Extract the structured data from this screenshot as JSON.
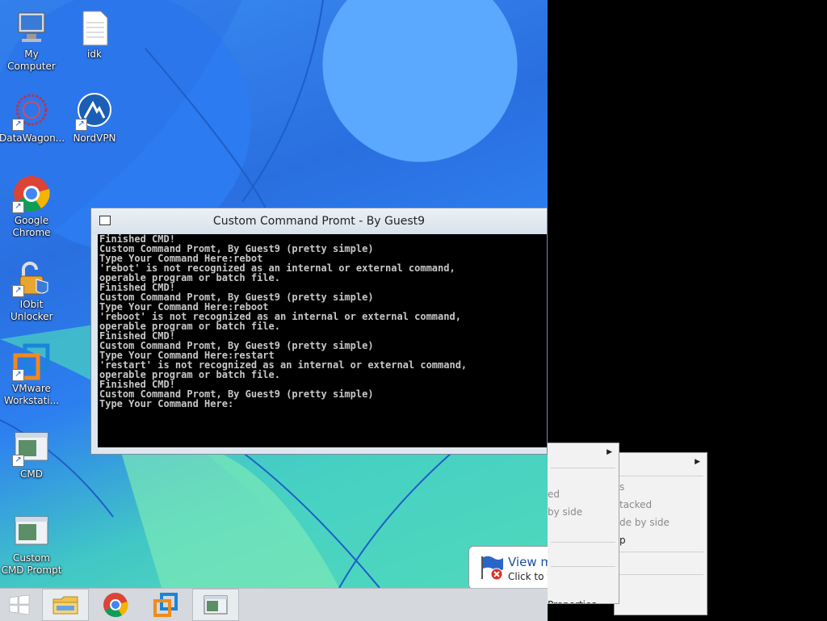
{
  "desktop": {
    "icons": [
      {
        "label": "My Computer"
      },
      {
        "label": "idk"
      },
      {
        "label": "DataWagon..."
      },
      {
        "label": "NordVPN"
      },
      {
        "label": "Google Chrome"
      },
      {
        "label": "IObit Unlocker"
      },
      {
        "label": "VMware Workstati..."
      },
      {
        "label": "CMD"
      },
      {
        "label": "Custom CMD Prompt"
      }
    ]
  },
  "console": {
    "title": "Custom Command Promt - By Guest9",
    "lines": [
      "Finished CMD!",
      "Custom Command Promt, By Guest9 (pretty simple)",
      "Type Your Command Here:rebot",
      "'rebot' is not recognized as an internal or external command,",
      "operable program or batch file.",
      "Finished CMD!",
      "Custom Command Promt, By Guest9 (pretty simple)",
      "Type Your Command Here:reboot",
      "'reboot' is not recognized as an internal or external command,",
      "operable program or batch file.",
      "Finished CMD!",
      "Custom Command Promt, By Guest9 (pretty simple)",
      "Type Your Command Here:restart",
      "'restart' is not recognized as an internal or external command,",
      "operable program or batch file.",
      "Finished CMD!",
      "Custom Command Promt, By Guest9 (pretty simple)",
      "Type Your Command Here:"
    ]
  },
  "context_menu_front": {
    "items": [
      "ed",
      "by side",
      "Properties"
    ]
  },
  "context_menu_back": {
    "items": [
      "s",
      "tacked",
      "de by side",
      "p"
    ]
  },
  "balloon": {
    "title": "View m",
    "subtitle": "Click to v"
  },
  "taskbar": {
    "buttons": [
      "start-button",
      "file-explorer",
      "google-chrome",
      "vmware",
      "custom-cmd"
    ]
  }
}
